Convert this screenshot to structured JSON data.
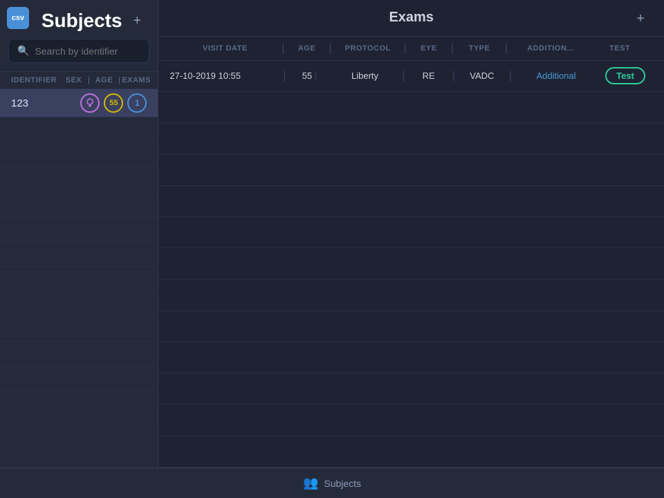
{
  "app": {
    "logo_text": "csv",
    "title": "Exams",
    "add_label": "+"
  },
  "sidebar": {
    "title": "Subjects",
    "add_label": "+",
    "search_placeholder": "Search by identifier",
    "columns": {
      "identifier": "IDENTIFIER",
      "sex": "SEX",
      "age": "AGE",
      "exams": "EXAMS"
    },
    "subjects": [
      {
        "id": "123",
        "sex_icon": "♀",
        "age": "55",
        "exams": "1"
      }
    ]
  },
  "exams_table": {
    "columns": {
      "visit_date": "VISIT DATE",
      "age": "AGE",
      "protocol": "PROTOCOL",
      "eye": "EYE",
      "type": "TYPE",
      "additional": "ADDITION...",
      "test": "TEST"
    },
    "rows": [
      {
        "visit_date": "27-10-2019 10:55",
        "age": "55",
        "protocol": "Liberty",
        "eye": "RE",
        "type": "VADC",
        "additional": "Additional",
        "test_label": "Test"
      }
    ]
  },
  "bottom_nav": {
    "icon": "👥",
    "label": "Subjects"
  }
}
